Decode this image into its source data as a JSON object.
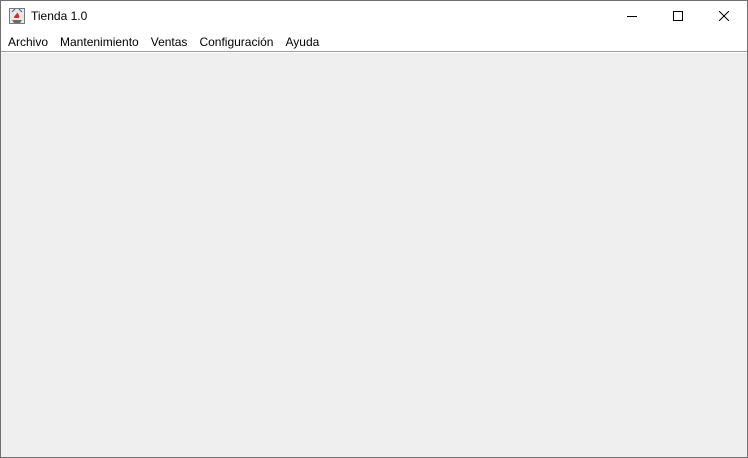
{
  "window": {
    "title": "Tienda 1.0",
    "app_icon": "java-coffee-cup-icon"
  },
  "window_controls": {
    "minimize_icon": "minimize-icon",
    "maximize_icon": "maximize-icon",
    "close_icon": "close-icon"
  },
  "menubar": {
    "items": [
      {
        "label": "Archivo"
      },
      {
        "label": "Mantenimiento"
      },
      {
        "label": "Ventas"
      },
      {
        "label": "Configuración"
      },
      {
        "label": "Ayuda"
      }
    ]
  },
  "colors": {
    "content_background": "#efefef",
    "titlebar_background": "#ffffff",
    "border": "#6f6f6f"
  }
}
